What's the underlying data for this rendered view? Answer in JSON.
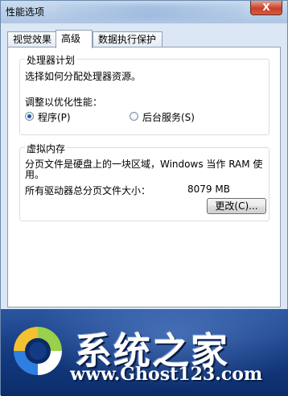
{
  "window": {
    "title": "性能选项",
    "close_label": "X"
  },
  "tabs": [
    {
      "label": "视觉效果",
      "active": false
    },
    {
      "label": "高级",
      "active": true
    },
    {
      "label": "数据执行保护",
      "active": false
    }
  ],
  "processor_scheduling": {
    "group_title": "处理器计划",
    "description": "选择如何分配处理器资源。",
    "adjust_label": "调整以优化性能：",
    "options": [
      {
        "label": "程序(P)",
        "checked": true
      },
      {
        "label": "后台服务(S)",
        "checked": false
      }
    ]
  },
  "virtual_memory": {
    "group_title": "虚拟内存",
    "description_line1": "分页文件是硬盘上的一块区域，Windows 当作 RAM 使",
    "description_line2": "用。",
    "total_label": "所有驱动器总分页文件大小：",
    "total_value": "8079 MB",
    "change_button": "更改(C)..."
  },
  "watermark": {
    "brand": "系统之家",
    "url": "www.Ghost123.com"
  },
  "colors": {
    "accent": "#1d5aa8",
    "banner": "#143a80"
  }
}
